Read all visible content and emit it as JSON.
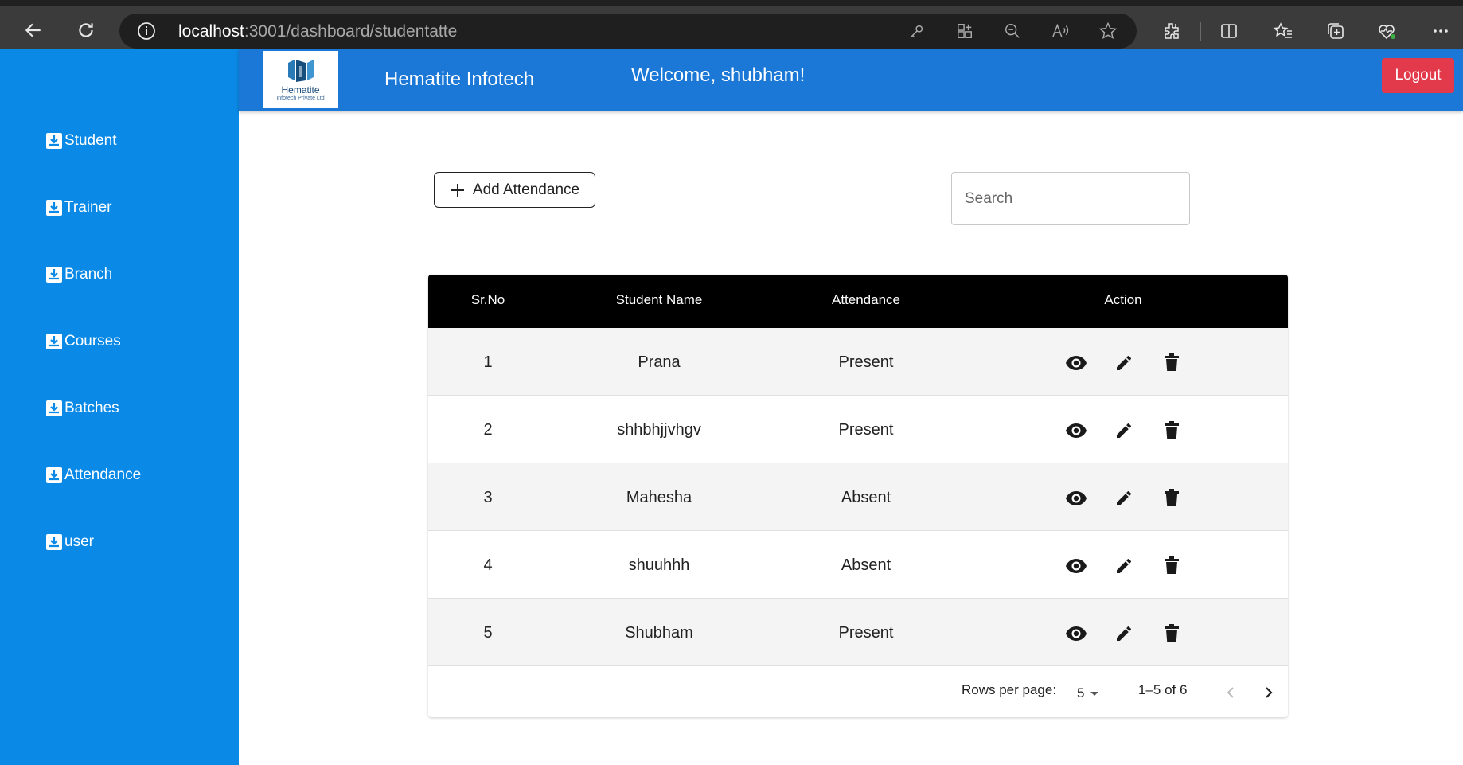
{
  "browser": {
    "url_host": "localhost",
    "url_rest": ":3001/dashboard/studentatte"
  },
  "sidebar": {
    "items": [
      {
        "label": "Student"
      },
      {
        "label": "Trainer"
      },
      {
        "label": "Branch"
      },
      {
        "label": "Courses"
      },
      {
        "label": "Batches"
      },
      {
        "label": "Attendance"
      },
      {
        "label": "user"
      }
    ]
  },
  "header": {
    "logo_name": "Hematite",
    "logo_sub": "Infotech Private Ltd",
    "brand": "Hematite Infotech",
    "welcome": "Welcome, shubham!",
    "logout_label": "Logout"
  },
  "toolbar": {
    "add_label": "Add Attendance",
    "search_placeholder": "Search"
  },
  "table": {
    "headers": [
      "Sr.No",
      "Student Name",
      "Attendance",
      "Action"
    ],
    "rows": [
      {
        "sr": "1",
        "name": "Prana",
        "attendance": "Present"
      },
      {
        "sr": "2",
        "name": "shhbhjjvhgv",
        "attendance": "Present"
      },
      {
        "sr": "3",
        "name": "Mahesha",
        "attendance": "Absent"
      },
      {
        "sr": "4",
        "name": "shuuhhh",
        "attendance": "Absent"
      },
      {
        "sr": "5",
        "name": "Shubham",
        "attendance": "Present"
      }
    ]
  },
  "pagination": {
    "rows_per_page_label": "Rows per page:",
    "rows_per_page_value": "5",
    "range": "1–5 of 6"
  },
  "colors": {
    "sidebar": "#0a8ae6",
    "topbar": "#1b78d6",
    "logout": "#e23a4a",
    "table_header": "#000000"
  }
}
